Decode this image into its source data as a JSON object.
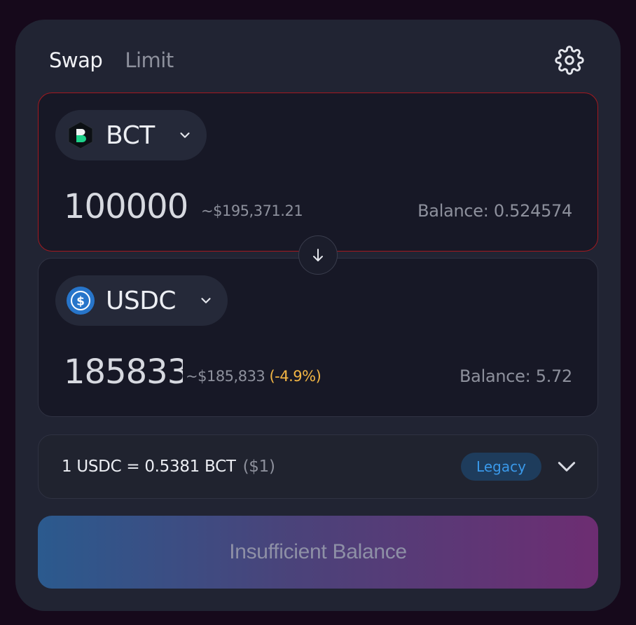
{
  "tabs": [
    {
      "label": "Swap",
      "active": true
    },
    {
      "label": "Limit",
      "active": false
    }
  ],
  "settings_icon": "gear-icon",
  "from": {
    "token_symbol": "BCT",
    "token_icon": "bct-token-icon",
    "amount": "100000",
    "usd_value": "~$195,371.21",
    "balance": "Balance: 0.524574",
    "error_border_color": "#a3191f"
  },
  "flip_icon": "arrow-down-icon",
  "to": {
    "token_symbol": "USDC",
    "token_icon": "usdc-token-icon",
    "amount": "185833",
    "usd_value": "~$185,833",
    "price_impact": "(-4.9%)",
    "balance": "Balance: 5.72"
  },
  "rate": {
    "text": "1 USDC = 0.5381 BCT",
    "usd": "($1)",
    "badge": "Legacy",
    "expand_icon": "chevron-down-icon"
  },
  "action_button": {
    "label": "Insufficient Balance"
  },
  "colors": {
    "accent_blue": "#3a99ea",
    "warning": "#f2b544",
    "usdc_blue": "#2775ca",
    "bct_green": "#1dd28a"
  }
}
